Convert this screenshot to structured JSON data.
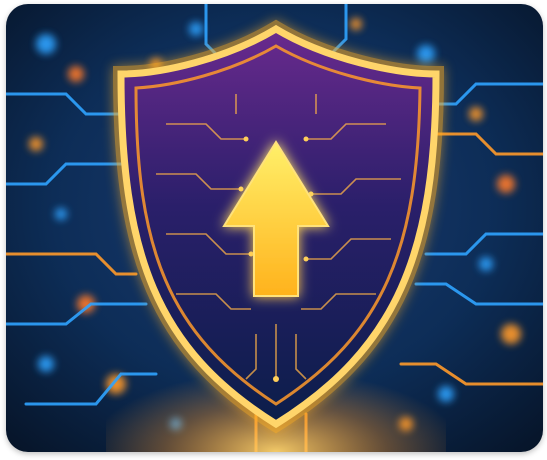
{
  "image": {
    "subject": "shield-with-upward-arrow",
    "colors": {
      "background_dark": "#071a33",
      "background_mid": "#0d2d57",
      "circuit_blue": "#2fa3ff",
      "circuit_orange": "#ff9a2a",
      "shield_glow": "#ffb020",
      "shield_inner_top": "#5a2a86",
      "shield_inner_bottom": "#0b1e4a",
      "arrow": "#ffd23a"
    }
  }
}
